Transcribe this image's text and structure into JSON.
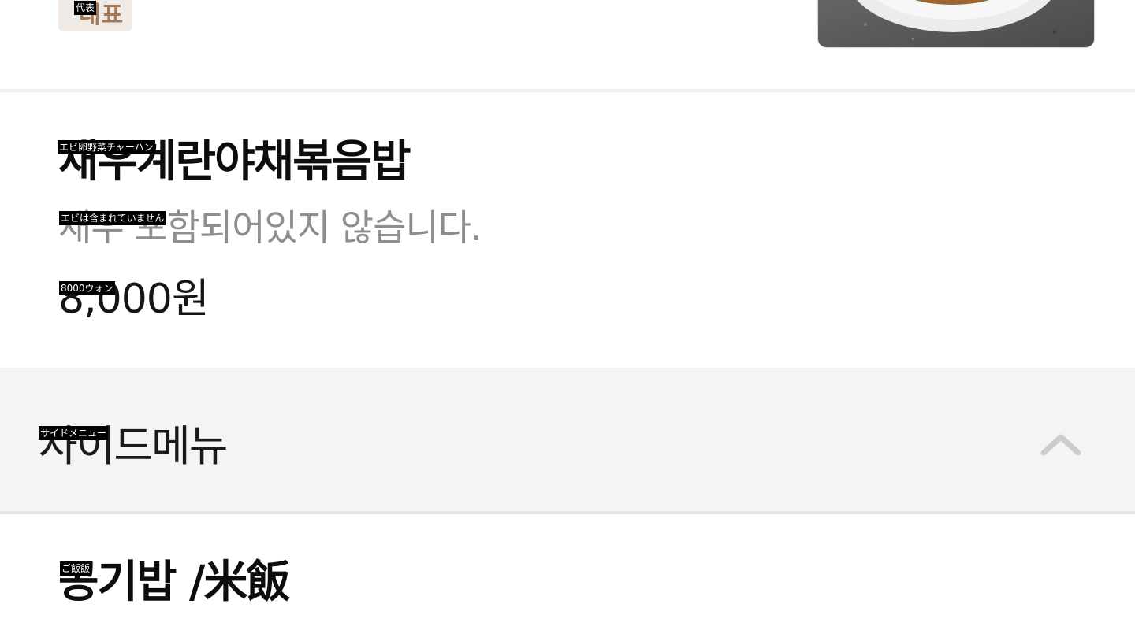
{
  "previous_item": {
    "badge_label": "대표",
    "badge_translation": "代表"
  },
  "featured_item": {
    "name": "새우계란야채볶음밥",
    "name_translation": "エビ卵野菜チャーハン",
    "description": "새우 포함되어있지 않습니다.",
    "description_translation": "エビは含まれていません",
    "price": "8,000원",
    "price_translation": "8000ウォン"
  },
  "side_menu": {
    "title": "사이드메뉴",
    "title_translation": "サイドメニュー",
    "toggle_icon": "chevron-up-icon",
    "expanded": true
  },
  "next_item": {
    "name": "공기밥 /米飯",
    "name_translation": "ご飯飯"
  },
  "colors": {
    "section_bg": "#f4f4f4",
    "badge_bg": "#efeae6",
    "badge_text": "#a47a56",
    "description_text": "#8e8e8e",
    "chevron": "#cccccc"
  }
}
